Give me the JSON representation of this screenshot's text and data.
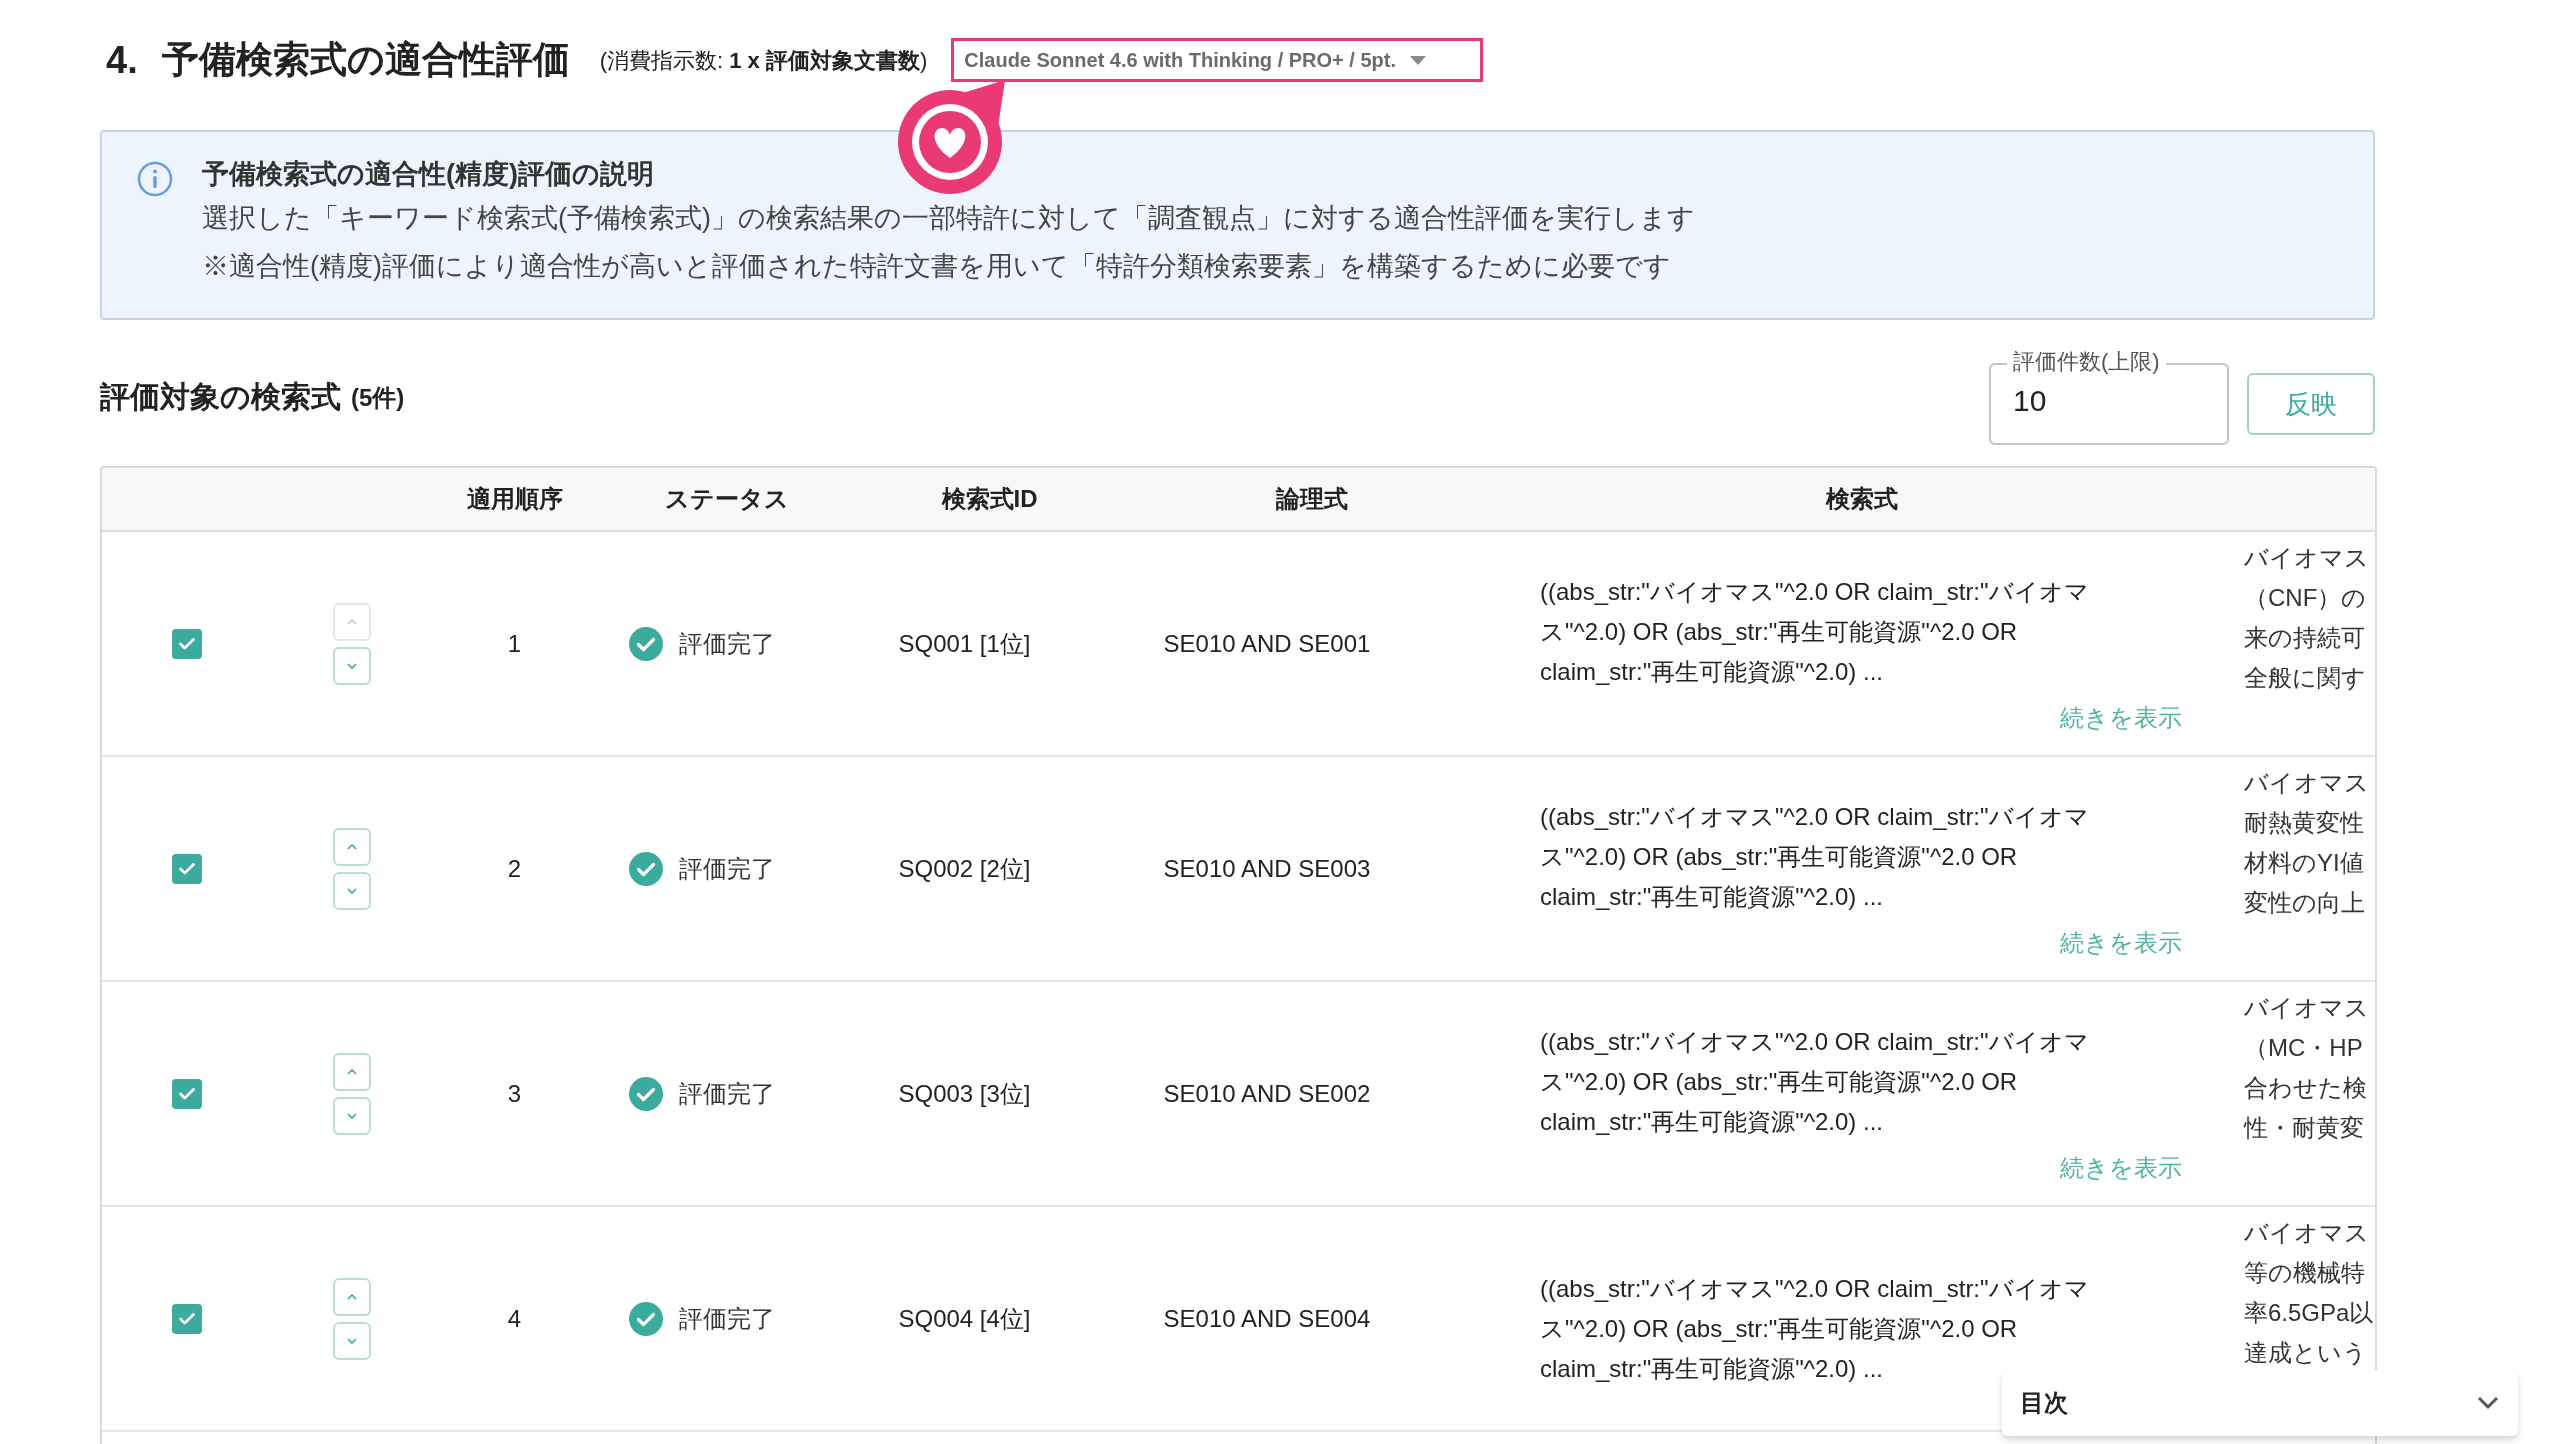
{
  "section": {
    "number": "4.",
    "title": "予備検索式の適合性評価",
    "cost": "(消費指示数: **1 x 評価対象文書数**)"
  },
  "model_select": {
    "value": "Claude Sonnet 4.6 with Thinking / PRO+ / 5pt."
  },
  "info": {
    "title": "予備検索式の適合性(精度)評価の説明",
    "lines": [
      "選択した「キーワード検索式(予備検索式)」の検索結果の一部特許に対して「調査観点」に対する適合性評価を実行します",
      "※適合性(精度)評価により適合性が高いと評価された特許文書を用いて「特許分類検索要素」を構築するために必要です"
    ]
  },
  "list_header": {
    "title": "評価対象の検索式",
    "count": "(5件)"
  },
  "limit_field": {
    "label": "評価件数(上限)",
    "value": "10"
  },
  "apply_button": "反映",
  "table": {
    "columns": [
      "適用順序",
      "ステータス",
      "検索式ID",
      "論理式",
      "検索式"
    ],
    "rows": [
      {
        "checked": true,
        "up_disabled": true,
        "order": "1",
        "status": {
          "kind": "done",
          "label": "評価完了"
        },
        "id": "SQ001 [1位]",
        "logic": "SE010 AND SE001",
        "query": "((abs_str:\"バイオマス\"^2.0 OR claim_str:\"バイオマス\"^2.0) OR (abs_str:\"再生可能資源\"^2.0 OR claim_str:\"再生可能資源\"^2.0) ...",
        "more": "続きを表示",
        "column_8": [
          "バイオマス",
          "（CNF）の",
          "来の持続可",
          "全般に関す"
        ]
      },
      {
        "checked": true,
        "up_disabled": false,
        "order": "2",
        "status": {
          "kind": "done",
          "label": "評価完了"
        },
        "id": "SQ002 [2位]",
        "logic": "SE010 AND SE003",
        "query": "((abs_str:\"バイオマス\"^2.0 OR claim_str:\"バイオマス\"^2.0) OR (abs_str:\"再生可能資源\"^2.0 OR claim_str:\"再生可能資源\"^2.0) ...",
        "more": "続きを表示",
        "column_8": [
          "バイオマス",
          "耐熱黄変性",
          "材料のYI値",
          "変性の向上"
        ]
      },
      {
        "checked": true,
        "up_disabled": false,
        "order": "3",
        "status": {
          "kind": "done",
          "label": "評価完了"
        },
        "id": "SQ003 [3位]",
        "logic": "SE010 AND SE002",
        "query": "((abs_str:\"バイオマス\"^2.0 OR claim_str:\"バイオマス\"^2.0) OR (abs_str:\"再生可能資源\"^2.0 OR claim_str:\"再生可能資源\"^2.0) ...",
        "more": "続きを表示",
        "column_8": [
          "バイオマス",
          "（MC・HP",
          "合わせた検",
          "性・耐黄変"
        ]
      },
      {
        "checked": true,
        "up_disabled": false,
        "order": "4",
        "status": {
          "kind": "done",
          "label": "評価完了"
        },
        "id": "SQ004 [4位]",
        "logic": "SE010 AND SE004",
        "query": "((abs_str:\"バイオマス\"^2.0 OR claim_str:\"バイオマス\"^2.0) OR (abs_str:\"再生可能資源\"^2.0 OR claim_str:\"再生可能資源\"^2.0) ...",
        "column_8": [
          "バイオマス",
          "等の機械特",
          "率6.5GPa以",
          "達成という"
        ]
      }
    ]
  },
  "toc": {
    "title": "目次",
    "expanded": false
  }
}
